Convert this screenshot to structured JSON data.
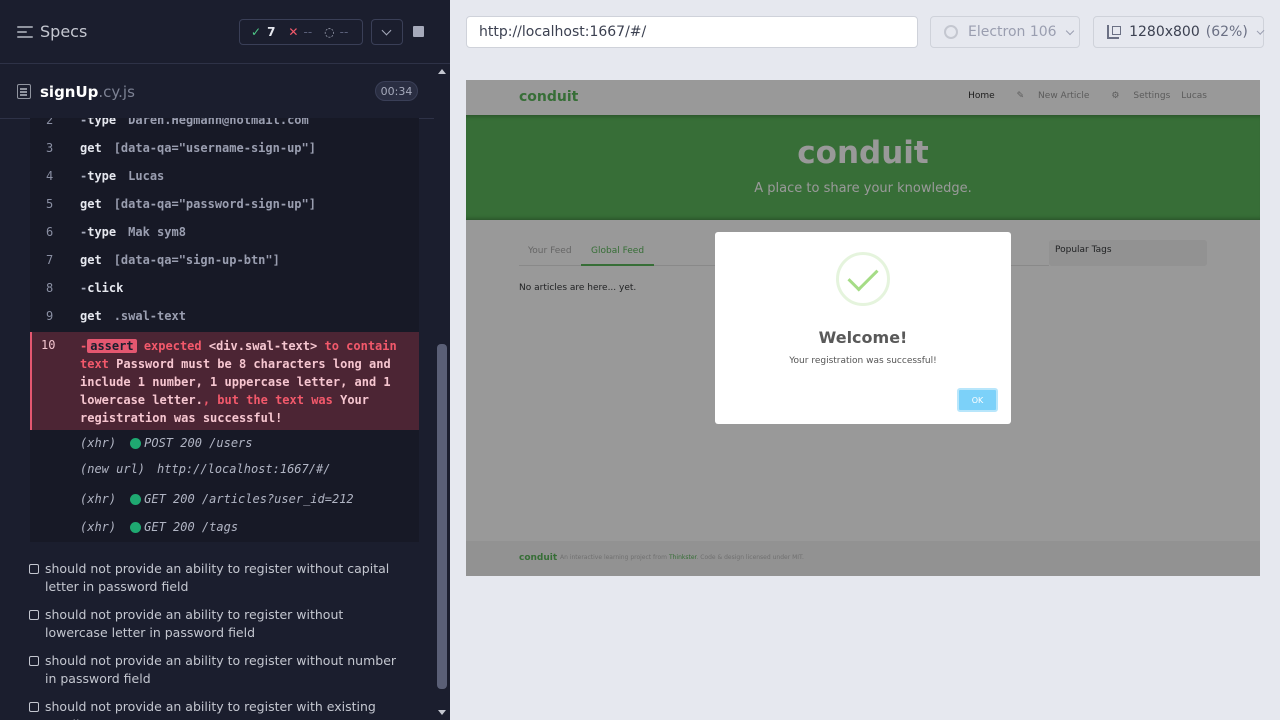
{
  "runner": {
    "title": "Specs",
    "stats": {
      "passed_icon": "✓",
      "passed": "7",
      "failed_icon": "✕",
      "failed": "--",
      "pending_icon": "◌",
      "pending": "--"
    },
    "file": {
      "name": "signUp",
      "ext": ".cy.js",
      "duration": "00:34"
    },
    "commands": [
      {
        "num": "2",
        "name": "type",
        "arg": "Daren.Hegmann@hotmail.com",
        "child": true
      },
      {
        "num": "3",
        "name": "get",
        "arg": "[data-qa=\"username-sign-up\"]",
        "child": false
      },
      {
        "num": "4",
        "name": "type",
        "arg": "Lucas",
        "child": true
      },
      {
        "num": "5",
        "name": "get",
        "arg": "[data-qa=\"password-sign-up\"]",
        "child": false
      },
      {
        "num": "6",
        "name": "type",
        "arg": "Mak sym8",
        "child": true
      },
      {
        "num": "7",
        "name": "get",
        "arg": "[data-qa=\"sign-up-btn\"]",
        "child": false
      },
      {
        "num": "8",
        "name": "click",
        "arg": "",
        "child": true
      },
      {
        "num": "9",
        "name": "get",
        "arg": ".swal-text",
        "child": false
      }
    ],
    "assert": {
      "num": "10",
      "badge": "assert",
      "expected": "expected",
      "element": "<div.swal-text>",
      "to_contain": "to contain text",
      "value": "Password must be 8 characters long and include 1 number, 1 uppercase letter, and 1 lowercase letter.",
      "but": ", but the text was",
      "actual": "Your registration was successful!"
    },
    "xhr": [
      {
        "type": "(xhr)",
        "status": "POST 200 /users",
        "dot": true
      },
      {
        "type": "(new url)",
        "status": "http://localhost:1667/#/",
        "dot": false
      },
      {
        "type": "(xhr)",
        "status": "GET 200 /articles?user_id=212",
        "dot": true
      },
      {
        "type": "(xhr)",
        "status": "GET 200 /tags",
        "dot": true
      }
    ],
    "tests": [
      "should not provide an ability to register without capital letter in password field",
      "should not provide an ability to register without lowercase letter in password field",
      "should not provide an ability to register without number in password field",
      "should not provide an ability to register with existing email"
    ]
  },
  "preview": {
    "url": "http://localhost:1667/#/",
    "browser": "Electron 106",
    "viewport": "1280x800",
    "zoom": "(62%)"
  },
  "app": {
    "brand": "conduit",
    "nav": [
      "Home",
      "New Article",
      "Settings",
      "Lucas"
    ],
    "nav_icons": [
      "",
      "edit-icon",
      "gear-icon",
      ""
    ],
    "banner_title": "conduit",
    "banner_subtitle": "A place to share your knowledge.",
    "tabs": [
      "Your Feed",
      "Global Feed"
    ],
    "empty_text": "No articles are here... yet.",
    "popular_tags": "Popular Tags",
    "footer_brand": "conduit",
    "footer_text_1": "An interactive learning project from",
    "footer_link": "Thinkster",
    "footer_text_2": ". Code & design licensed under MIT.",
    "modal": {
      "title": "Welcome!",
      "text": "Your registration was successful!",
      "ok": "OK"
    }
  },
  "colors": {
    "runner_bg": "#1b1e2e",
    "fail": "#f3596b",
    "pass": "#4ec987",
    "conduit_green": "#5cb85c"
  }
}
